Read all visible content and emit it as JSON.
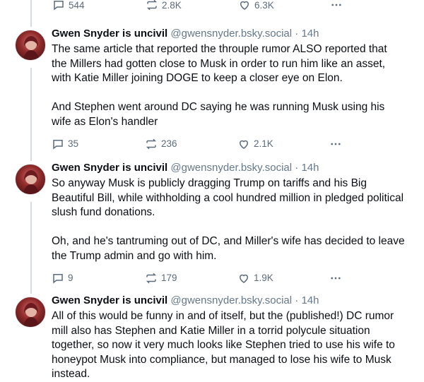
{
  "top_actions": {
    "replies": "544",
    "reposts": "2.8K",
    "likes": "6.3K"
  },
  "posts": [
    {
      "author": "Gwen Snyder is uncivil",
      "handle": "@gwensnyder.bsky.social",
      "sep": "·",
      "time": "14h",
      "paragraphs": [
        "The same article that reported the throuple rumor ALSO reported that the Millers had gotten close to Musk in order to run him like an asset, with Katie Miller joining DOGE to keep a closer eye on Elon.",
        "And Stephen went around DC saying he was running Musk using his wife as Elon's handler"
      ],
      "replies": "35",
      "reposts": "236",
      "likes": "2.1K"
    },
    {
      "author": "Gwen Snyder is uncivil",
      "handle": "@gwensnyder.bsky.social",
      "sep": "·",
      "time": "14h",
      "paragraphs": [
        "So anyway Musk is publicly dragging Trump on tariffs and his Big Beautiful Bill, while withholding a cool hundred million in pledged political slush fund donations.",
        "Oh, and he's tantruming out of DC, and Miller's wife has decided to leave the Trump admin and go with him."
      ],
      "replies": "9",
      "reposts": "179",
      "likes": "1.9K"
    },
    {
      "author": "Gwen Snyder is uncivil",
      "handle": "@gwensnyder.bsky.social",
      "sep": "·",
      "time": "14h",
      "paragraphs": [
        "All of this would be funny in and of itself, but the (published!) DC rumor mill also has Stephen and Katie Miller in a torrid polycule situation together, so now it very much looks like Stephen tried to use his wife to honeypot Musk into compliance, but managed to lose his wife to Musk instead."
      ]
    }
  ],
  "icons": {
    "reply": "reply-icon",
    "repost": "repost-icon",
    "like": "heart-icon",
    "more": "more-icon"
  }
}
